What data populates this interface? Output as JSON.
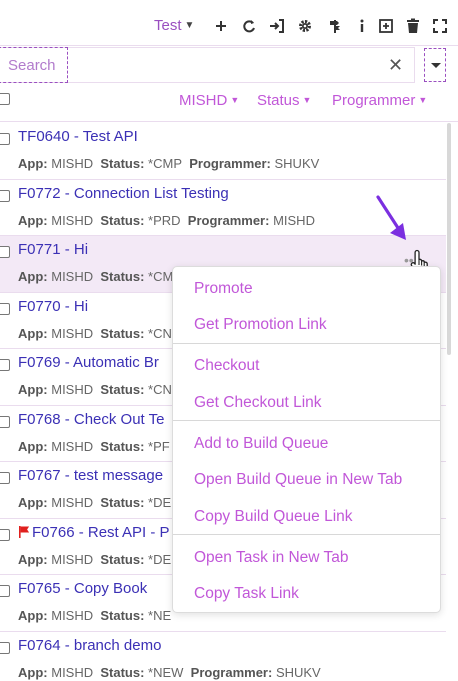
{
  "toolbar": {
    "environment": "Test",
    "icons": [
      "add-icon",
      "refresh-icon",
      "sign-in-icon",
      "settings-icon",
      "signpost-icon",
      "info-icon",
      "add-box-icon",
      "delete-icon",
      "fullscreen-icon"
    ]
  },
  "search": {
    "placeholder": "Search",
    "value": ""
  },
  "filters": [
    {
      "label": "MISHD"
    },
    {
      "label": "Status"
    },
    {
      "label": "Programmer"
    }
  ],
  "labels": {
    "app": "App:",
    "status": "Status:",
    "programmer": "Programmer:"
  },
  "tasks": [
    {
      "title": "TF0640 - Test API",
      "app": "MISHD",
      "status": "*CMP",
      "programmer": "SHUKV"
    },
    {
      "title": "F0772 - Connection List Testing",
      "app": "MISHD",
      "status": "*PRD",
      "programmer": "MISHD"
    },
    {
      "title": "F0771 - Hi",
      "app": "MISHD",
      "status": "*CM",
      "programmer": ""
    },
    {
      "title": "F0770 - Hi",
      "app": "MISHD",
      "status": "*CN",
      "programmer": ""
    },
    {
      "title": "F0769 - Automatic Br",
      "app": "MISHD",
      "status": "*CN",
      "programmer": ""
    },
    {
      "title": "F0768 - Check Out Te",
      "app": "MISHD",
      "status": "*PF",
      "programmer": ""
    },
    {
      "title": "F0767 - test message",
      "app": "MISHD",
      "status": "*DE",
      "programmer": ""
    },
    {
      "title": "F0766 - Rest API - P",
      "app": "MISHD",
      "status": "*DE",
      "programmer": ""
    },
    {
      "title": "F0765 - Copy Book",
      "app": "MISHD",
      "status": "*NE",
      "programmer": ""
    },
    {
      "title": "F0764 - branch demo",
      "app": "MISHD",
      "status": "*NEW",
      "programmer": "SHUKV"
    }
  ],
  "context_menu": {
    "items": [
      "Promote",
      "Get Promotion Link",
      "Checkout",
      "Get Checkout Link",
      "Add to Build Queue",
      "Open Build Queue in New Tab",
      "Copy Build Queue Link",
      "Open Task in New Tab",
      "Copy Task Link"
    ]
  },
  "colors": {
    "accent": "#c157d8",
    "link": "#3b30b5",
    "highlight_row": "#f3e9f6",
    "flag": "#e0201e",
    "annotation_arrow": "#7b2fe0"
  }
}
